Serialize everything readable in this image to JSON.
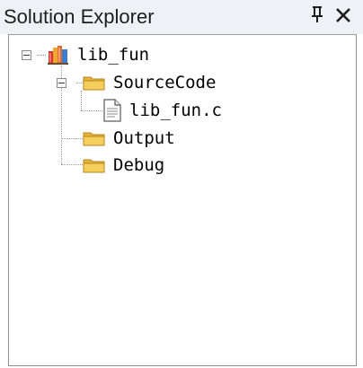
{
  "panel": {
    "title": "Solution Explorer",
    "pin_glyph": "p",
    "close_glyph": "✕"
  },
  "tree": {
    "project": {
      "label": "lib_fun",
      "icon": "project-icon",
      "expanded": true
    },
    "source_folder": {
      "label": "SourceCode",
      "icon": "folder-icon",
      "expanded": true
    },
    "source_file": {
      "label": "lib_fun.c",
      "icon": "file-icon"
    },
    "output_folder": {
      "label": "Output",
      "icon": "folder-icon"
    },
    "debug_folder": {
      "label": "Debug",
      "icon": "folder-icon"
    }
  },
  "colors": {
    "titlebar_bg": "#eef1f6",
    "folder_yellow": "#f2c64b",
    "border": "#8a8f98"
  }
}
